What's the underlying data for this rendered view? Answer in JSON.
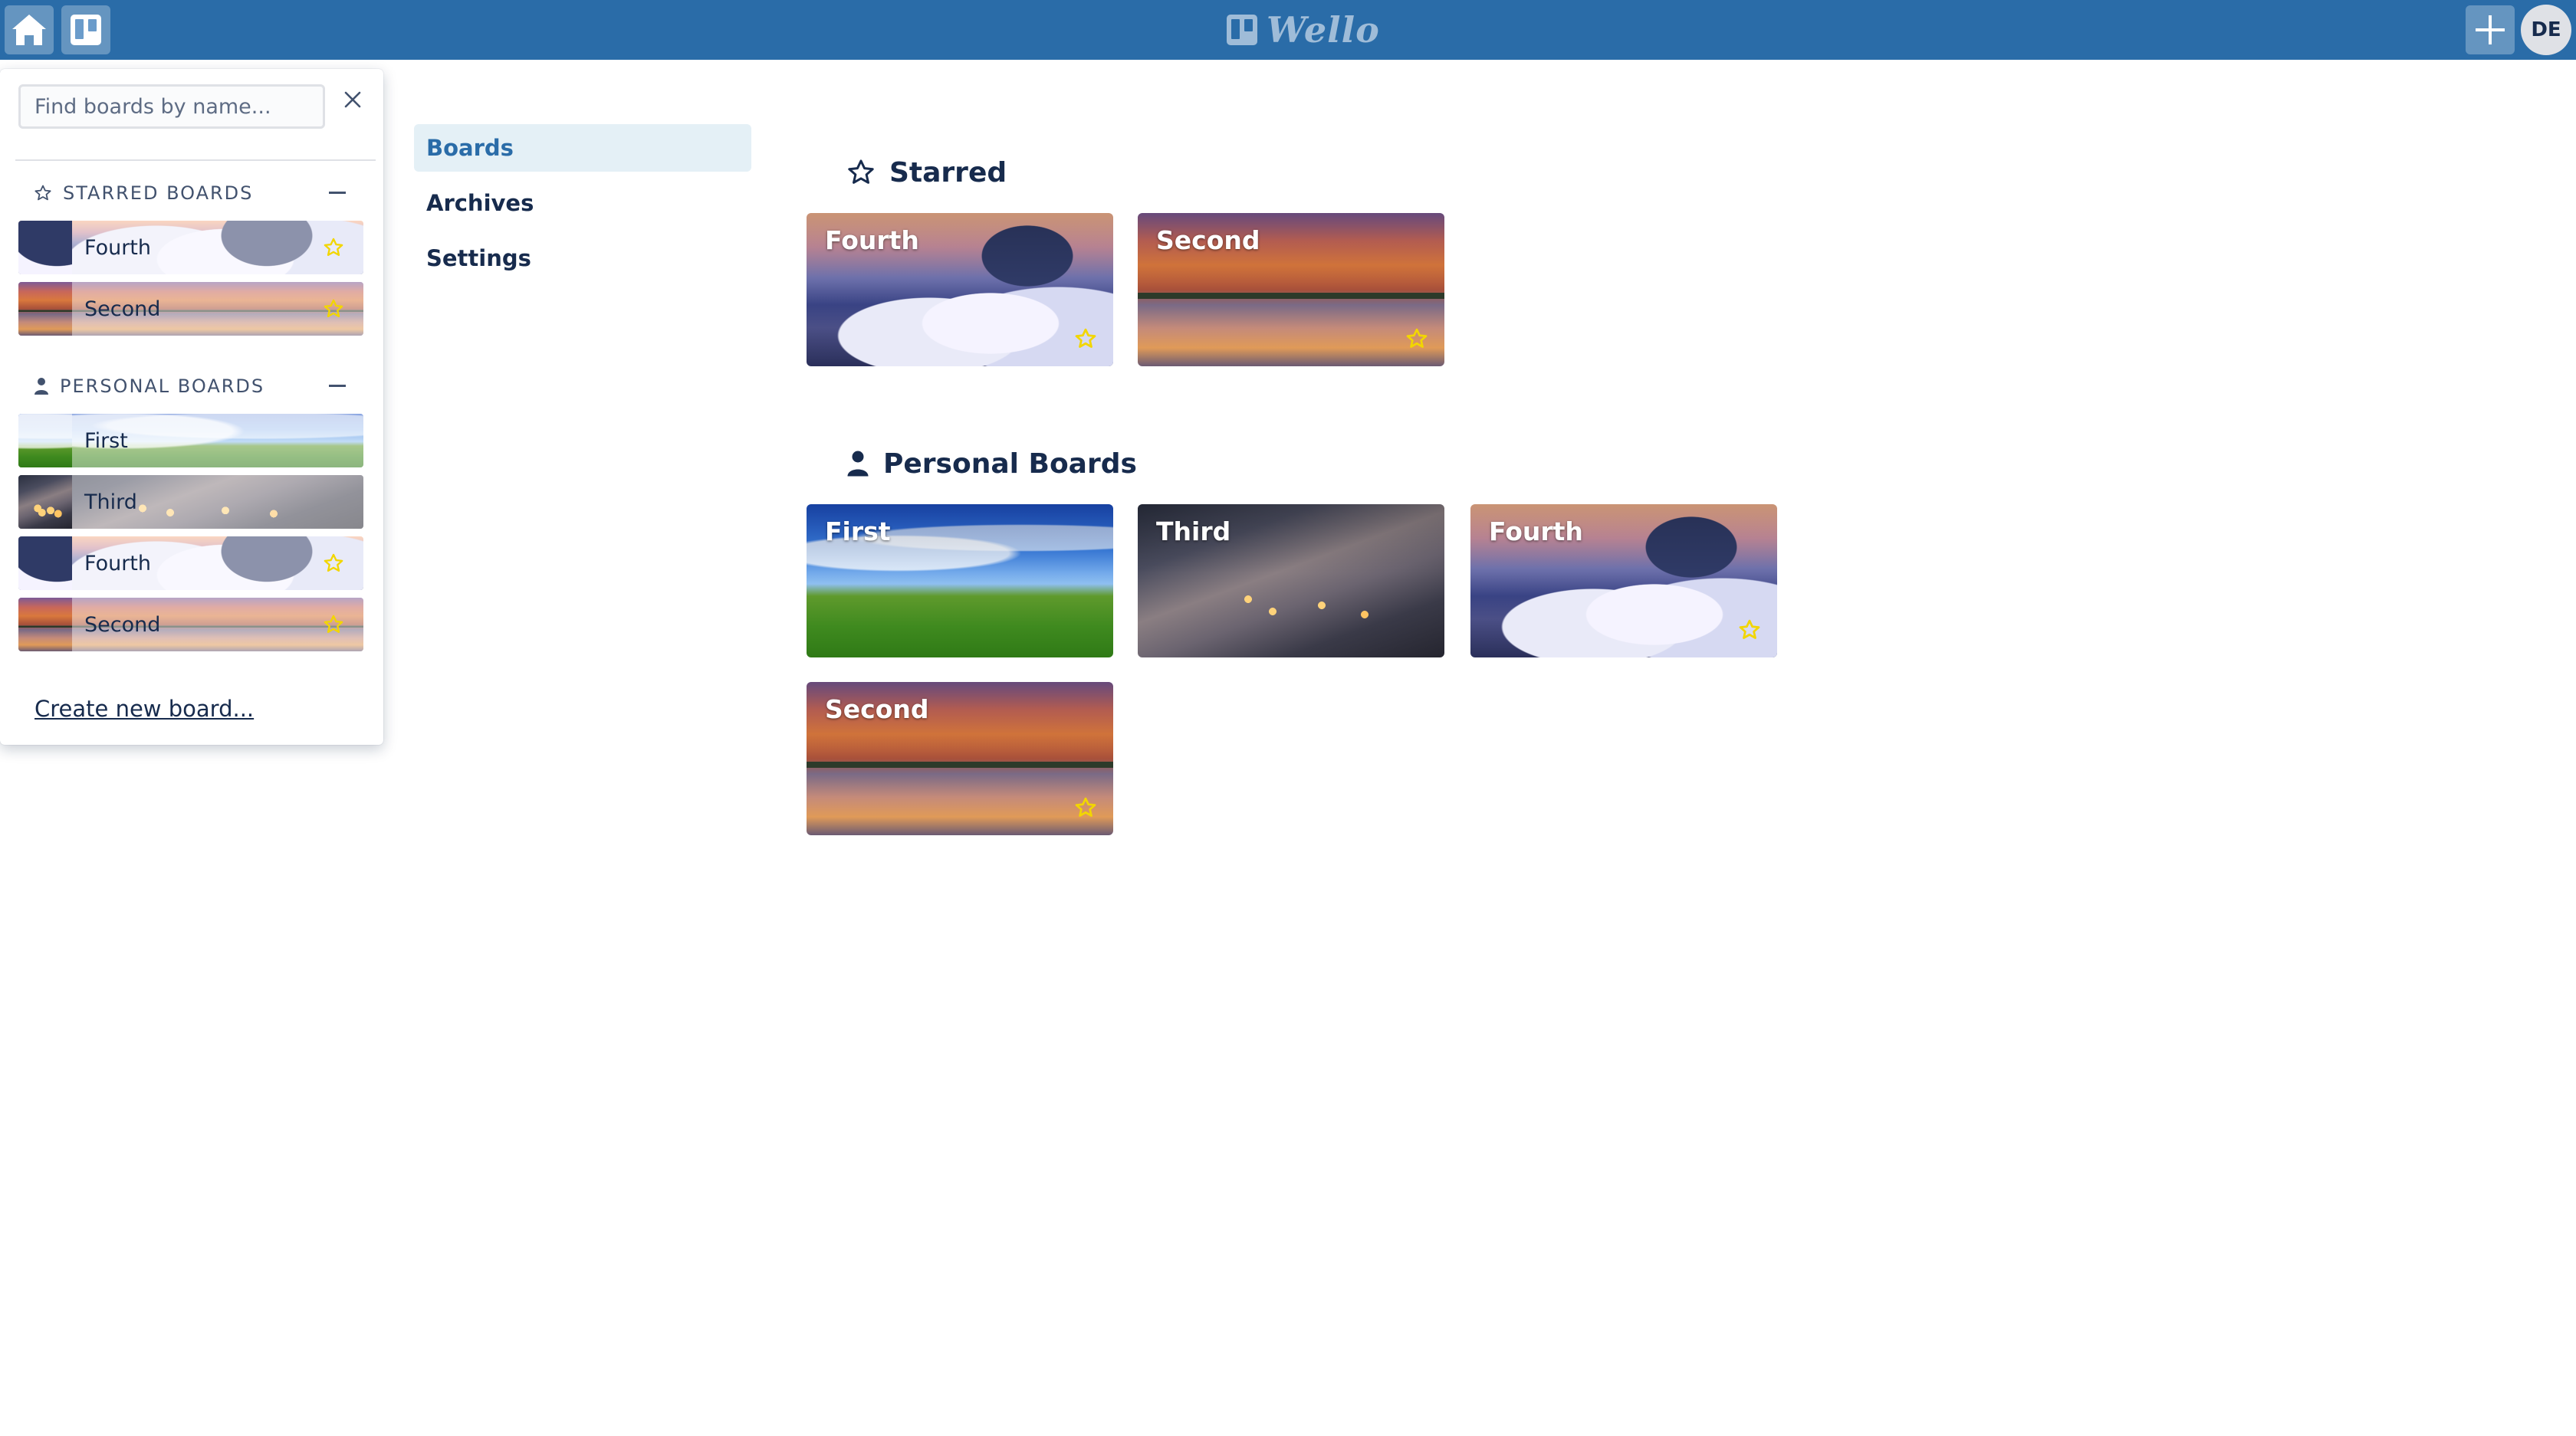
{
  "app": {
    "name": "Wello"
  },
  "header": {
    "home_icon": "home-icon",
    "boards_icon": "boards-icon",
    "add_icon": "plus-icon",
    "avatar_initials": "DE",
    "color": "#2a6ca8"
  },
  "drawer": {
    "search_placeholder": "Find boards by name...",
    "close_icon": "close-icon",
    "starred": {
      "label": "STARRED BOARDS",
      "icon": "star-outline-icon",
      "collapse_icon": "minus-icon",
      "boards": [
        {
          "name": "Fourth",
          "starred": true
        },
        {
          "name": "Second",
          "starred": true
        }
      ]
    },
    "personal": {
      "label": "PERSONAL BOARDS",
      "icon": "person-icon",
      "collapse_icon": "minus-icon",
      "boards": [
        {
          "name": "First",
          "starred": false
        },
        {
          "name": "Third",
          "starred": false
        },
        {
          "name": "Fourth",
          "starred": true
        },
        {
          "name": "Second",
          "starred": true
        }
      ]
    },
    "create_link": "Create new board..."
  },
  "nav": {
    "items": [
      {
        "label": "Boards",
        "active": true
      },
      {
        "label": "Archives",
        "active": false
      },
      {
        "label": "Settings",
        "active": false
      }
    ]
  },
  "main": {
    "starred": {
      "title": "Starred",
      "icon": "star-outline-icon",
      "boards": [
        {
          "name": "Fourth",
          "starred": true
        },
        {
          "name": "Second",
          "starred": true
        }
      ]
    },
    "personal": {
      "title": "Personal Boards",
      "icon": "person-icon",
      "boards": [
        {
          "name": "First",
          "starred": false
        },
        {
          "name": "Third",
          "starred": false
        },
        {
          "name": "Fourth",
          "starred": true
        },
        {
          "name": "Second",
          "starred": true
        }
      ]
    }
  },
  "colors": {
    "header": "#2a6ca8",
    "accent": "#2a6ca8",
    "nav_active_bg": "#e4f0f6",
    "star": "#f2d600",
    "text": "#172b4d"
  }
}
